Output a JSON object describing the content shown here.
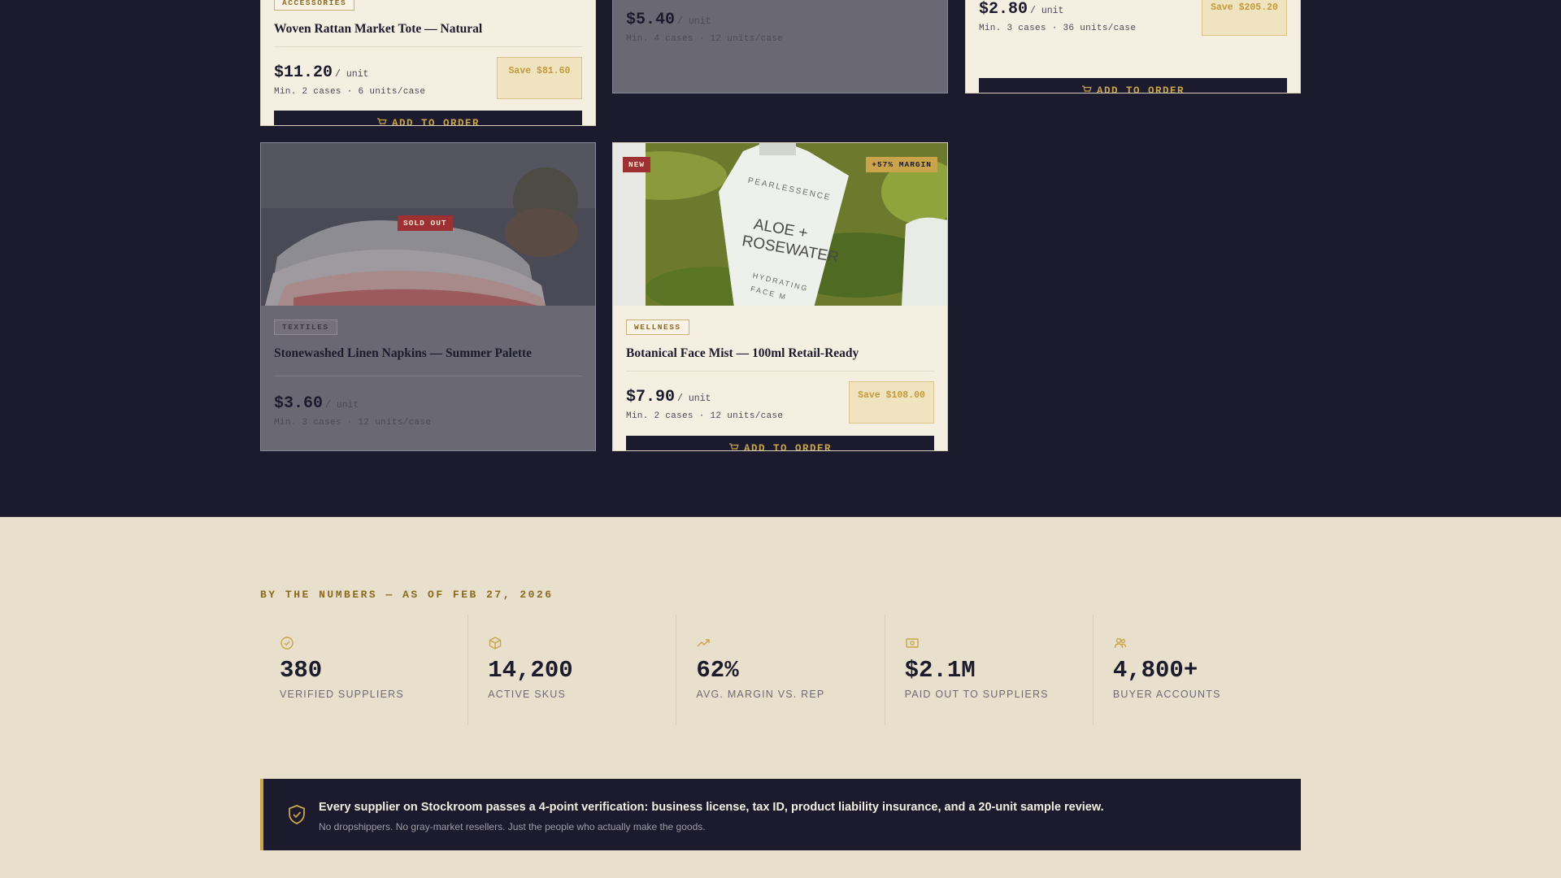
{
  "products": [
    {
      "category": "ACCESSORIES",
      "title": "Woven Rattan Market Tote — Natural",
      "price": "$11.20",
      "per": "/ unit",
      "min": "Min. 2 cases · 6 units/case",
      "save": "Save $81.60",
      "button": "ADD TO ORDER"
    },
    {
      "price": "$5.40",
      "per": "/ unit",
      "min": "Min. 4 cases · 12 units/case"
    },
    {
      "price": "$2.80",
      "per": "/ unit",
      "min": "Min. 3 cases · 36 units/case",
      "save": "Save $205.20",
      "button": "ADD TO ORDER"
    },
    {
      "category": "TEXTILES",
      "title": "Stonewashed Linen Napkins — Summer Palette",
      "price": "$3.60",
      "per": "/ unit",
      "min": "Min. 3 cases · 12 units/case",
      "badge": "SOLD OUT"
    },
    {
      "category": "WELLNESS",
      "title": "Botanical Face Mist — 100ml Retail-Ready",
      "price": "$7.90",
      "per": "/ unit",
      "min": "Min. 2 cases · 12 units/case",
      "save": "Save $108.00",
      "button": "ADD TO ORDER",
      "badge_new": "NEW",
      "badge_margin": "+57% MARGIN",
      "bottle_brand": "PEARLESSENCE",
      "bottle_line1": "ALOE +",
      "bottle_line2": "ROSEWATER",
      "bottle_line3": "HYDRATING",
      "bottle_line4": "FACE M"
    }
  ],
  "stats": {
    "eyebrow": "BY THE NUMBERS — AS OF FEB 27, 2026",
    "items": [
      {
        "icon": "check-circle-icon",
        "value": "380",
        "label": "VERIFIED SUPPLIERS"
      },
      {
        "icon": "box-icon",
        "value": "14,200",
        "label": "ACTIVE SKUS"
      },
      {
        "icon": "trending-up-icon",
        "value": "62%",
        "label": "AVG. MARGIN VS. REP"
      },
      {
        "icon": "cash-icon",
        "value": "$2.1M",
        "label": "PAID OUT TO SUPPLIERS"
      },
      {
        "icon": "users-icon",
        "value": "4,800+",
        "label": "BUYER ACCOUNTS"
      }
    ]
  },
  "notice": {
    "icon": "shield-check-icon",
    "main": "Every supplier on Stockroom passes a 4-point verification: business license, tax ID, product liability insurance, and a 20-unit sample review.",
    "sub": "No dropshippers. No gray-market resellers. Just the people who actually make the goods."
  },
  "colors": {
    "navy": "#1c1b2e",
    "gold": "#c9a44a",
    "cream": "#f5efe1",
    "sand": "#e8e0cc",
    "red": "#9e3033"
  }
}
